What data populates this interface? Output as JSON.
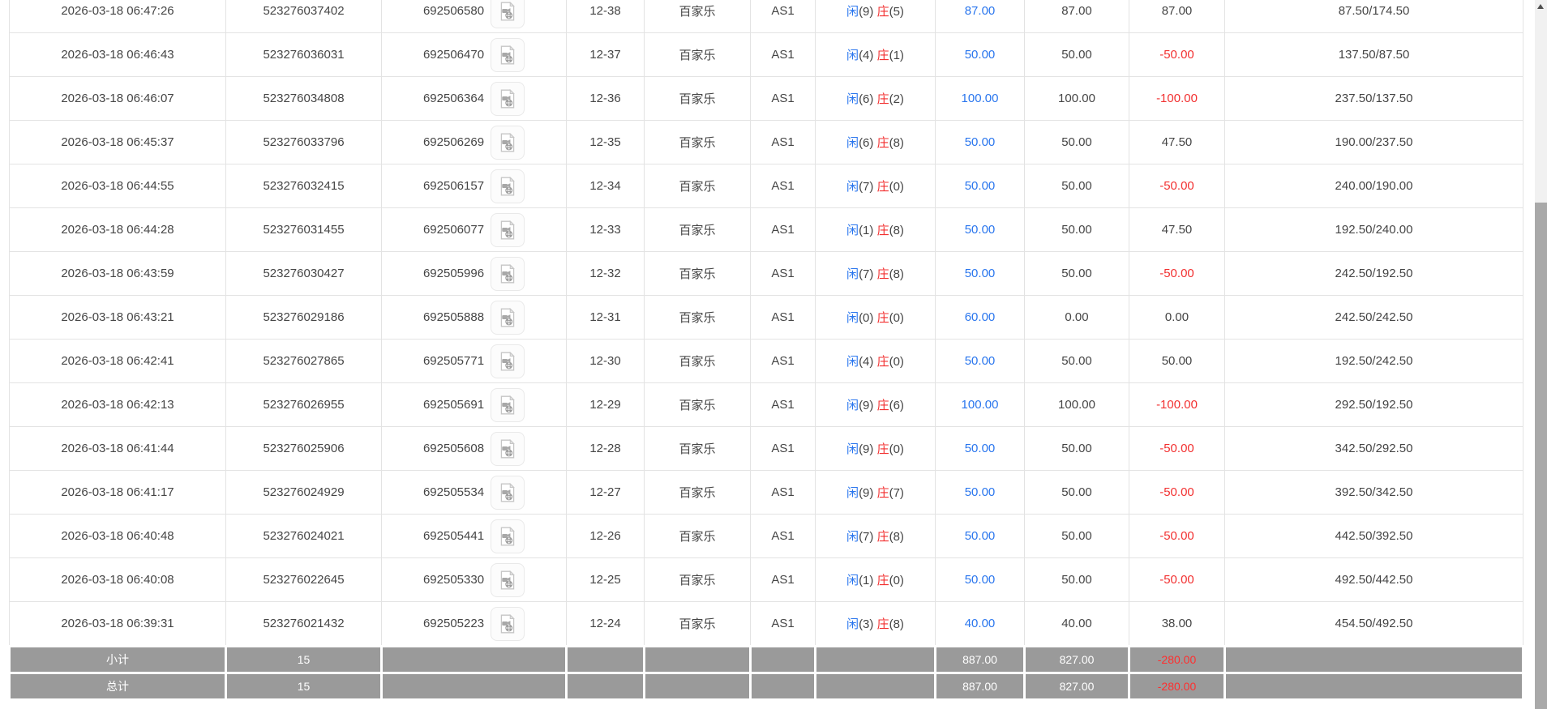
{
  "colors": {
    "blue": "#2a76ee",
    "red": "#f23030",
    "footer_bg": "#9a9a9a",
    "border": "#e3e3e3",
    "text": "#454545",
    "footer_text": "#ffffff"
  },
  "icons": {
    "video": "video-file-icon",
    "scroll_up": "▲"
  },
  "table": {
    "rows": [
      {
        "time": "2026-03-18 06:47:26",
        "bet_id": "523276037402",
        "game_id": "692506580",
        "round": "12-38",
        "game": "百家乐",
        "table": "AS1",
        "p_label": "闲",
        "p_score": "(9)",
        "b_label": "庄",
        "b_score": "(5)",
        "bet": "87.00",
        "valid": "87.00",
        "win_loss": "87.00",
        "balance": "87.50/174.50"
      },
      {
        "time": "2026-03-18 06:46:43",
        "bet_id": "523276036031",
        "game_id": "692506470",
        "round": "12-37",
        "game": "百家乐",
        "table": "AS1",
        "p_label": "闲",
        "p_score": "(4)",
        "b_label": "庄",
        "b_score": "(1)",
        "bet": "50.00",
        "valid": "50.00",
        "win_loss": "-50.00",
        "balance": "137.50/87.50"
      },
      {
        "time": "2026-03-18 06:46:07",
        "bet_id": "523276034808",
        "game_id": "692506364",
        "round": "12-36",
        "game": "百家乐",
        "table": "AS1",
        "p_label": "闲",
        "p_score": "(6)",
        "b_label": "庄",
        "b_score": "(2)",
        "bet": "100.00",
        "valid": "100.00",
        "win_loss": "-100.00",
        "balance": "237.50/137.50"
      },
      {
        "time": "2026-03-18 06:45:37",
        "bet_id": "523276033796",
        "game_id": "692506269",
        "round": "12-35",
        "game": "百家乐",
        "table": "AS1",
        "p_label": "闲",
        "p_score": "(6)",
        "b_label": "庄",
        "b_score": "(8)",
        "bet": "50.00",
        "valid": "50.00",
        "win_loss": "47.50",
        "balance": "190.00/237.50"
      },
      {
        "time": "2026-03-18 06:44:55",
        "bet_id": "523276032415",
        "game_id": "692506157",
        "round": "12-34",
        "game": "百家乐",
        "table": "AS1",
        "p_label": "闲",
        "p_score": "(7)",
        "b_label": "庄",
        "b_score": "(0)",
        "bet": "50.00",
        "valid": "50.00",
        "win_loss": "-50.00",
        "balance": "240.00/190.00"
      },
      {
        "time": "2026-03-18 06:44:28",
        "bet_id": "523276031455",
        "game_id": "692506077",
        "round": "12-33",
        "game": "百家乐",
        "table": "AS1",
        "p_label": "闲",
        "p_score": "(1)",
        "b_label": "庄",
        "b_score": "(8)",
        "bet": "50.00",
        "valid": "50.00",
        "win_loss": "47.50",
        "balance": "192.50/240.00"
      },
      {
        "time": "2026-03-18 06:43:59",
        "bet_id": "523276030427",
        "game_id": "692505996",
        "round": "12-32",
        "game": "百家乐",
        "table": "AS1",
        "p_label": "闲",
        "p_score": "(7)",
        "b_label": "庄",
        "b_score": "(8)",
        "bet": "50.00",
        "valid": "50.00",
        "win_loss": "-50.00",
        "balance": "242.50/192.50"
      },
      {
        "time": "2026-03-18 06:43:21",
        "bet_id": "523276029186",
        "game_id": "692505888",
        "round": "12-31",
        "game": "百家乐",
        "table": "AS1",
        "p_label": "闲",
        "p_score": "(0)",
        "b_label": "庄",
        "b_score": "(0)",
        "bet": "60.00",
        "valid": "0.00",
        "win_loss": "0.00",
        "balance": "242.50/242.50"
      },
      {
        "time": "2026-03-18 06:42:41",
        "bet_id": "523276027865",
        "game_id": "692505771",
        "round": "12-30",
        "game": "百家乐",
        "table": "AS1",
        "p_label": "闲",
        "p_score": "(4)",
        "b_label": "庄",
        "b_score": "(0)",
        "bet": "50.00",
        "valid": "50.00",
        "win_loss": "50.00",
        "balance": "192.50/242.50"
      },
      {
        "time": "2026-03-18 06:42:13",
        "bet_id": "523276026955",
        "game_id": "692505691",
        "round": "12-29",
        "game": "百家乐",
        "table": "AS1",
        "p_label": "闲",
        "p_score": "(9)",
        "b_label": "庄",
        "b_score": "(6)",
        "bet": "100.00",
        "valid": "100.00",
        "win_loss": "-100.00",
        "balance": "292.50/192.50"
      },
      {
        "time": "2026-03-18 06:41:44",
        "bet_id": "523276025906",
        "game_id": "692505608",
        "round": "12-28",
        "game": "百家乐",
        "table": "AS1",
        "p_label": "闲",
        "p_score": "(9)",
        "b_label": "庄",
        "b_score": "(0)",
        "bet": "50.00",
        "valid": "50.00",
        "win_loss": "-50.00",
        "balance": "342.50/292.50"
      },
      {
        "time": "2026-03-18 06:41:17",
        "bet_id": "523276024929",
        "game_id": "692505534",
        "round": "12-27",
        "game": "百家乐",
        "table": "AS1",
        "p_label": "闲",
        "p_score": "(9)",
        "b_label": "庄",
        "b_score": "(7)",
        "bet": "50.00",
        "valid": "50.00",
        "win_loss": "-50.00",
        "balance": "392.50/342.50"
      },
      {
        "time": "2026-03-18 06:40:48",
        "bet_id": "523276024021",
        "game_id": "692505441",
        "round": "12-26",
        "game": "百家乐",
        "table": "AS1",
        "p_label": "闲",
        "p_score": "(7)",
        "b_label": "庄",
        "b_score": "(8)",
        "bet": "50.00",
        "valid": "50.00",
        "win_loss": "-50.00",
        "balance": "442.50/392.50"
      },
      {
        "time": "2026-03-18 06:40:08",
        "bet_id": "523276022645",
        "game_id": "692505330",
        "round": "12-25",
        "game": "百家乐",
        "table": "AS1",
        "p_label": "闲",
        "p_score": "(1)",
        "b_label": "庄",
        "b_score": "(0)",
        "bet": "50.00",
        "valid": "50.00",
        "win_loss": "-50.00",
        "balance": "492.50/442.50"
      },
      {
        "time": "2026-03-18 06:39:31",
        "bet_id": "523276021432",
        "game_id": "692505223",
        "round": "12-24",
        "game": "百家乐",
        "table": "AS1",
        "p_label": "闲",
        "p_score": "(3)",
        "b_label": "庄",
        "b_score": "(8)",
        "bet": "40.00",
        "valid": "40.00",
        "win_loss": "38.00",
        "balance": "454.50/492.50"
      }
    ],
    "subtotal": {
      "label": "小计",
      "count": "15",
      "bet": "887.00",
      "valid": "827.00",
      "win_loss": "-280.00"
    },
    "total": {
      "label": "总计",
      "count": "15",
      "bet": "887.00",
      "valid": "827.00",
      "win_loss": "-280.00"
    }
  }
}
